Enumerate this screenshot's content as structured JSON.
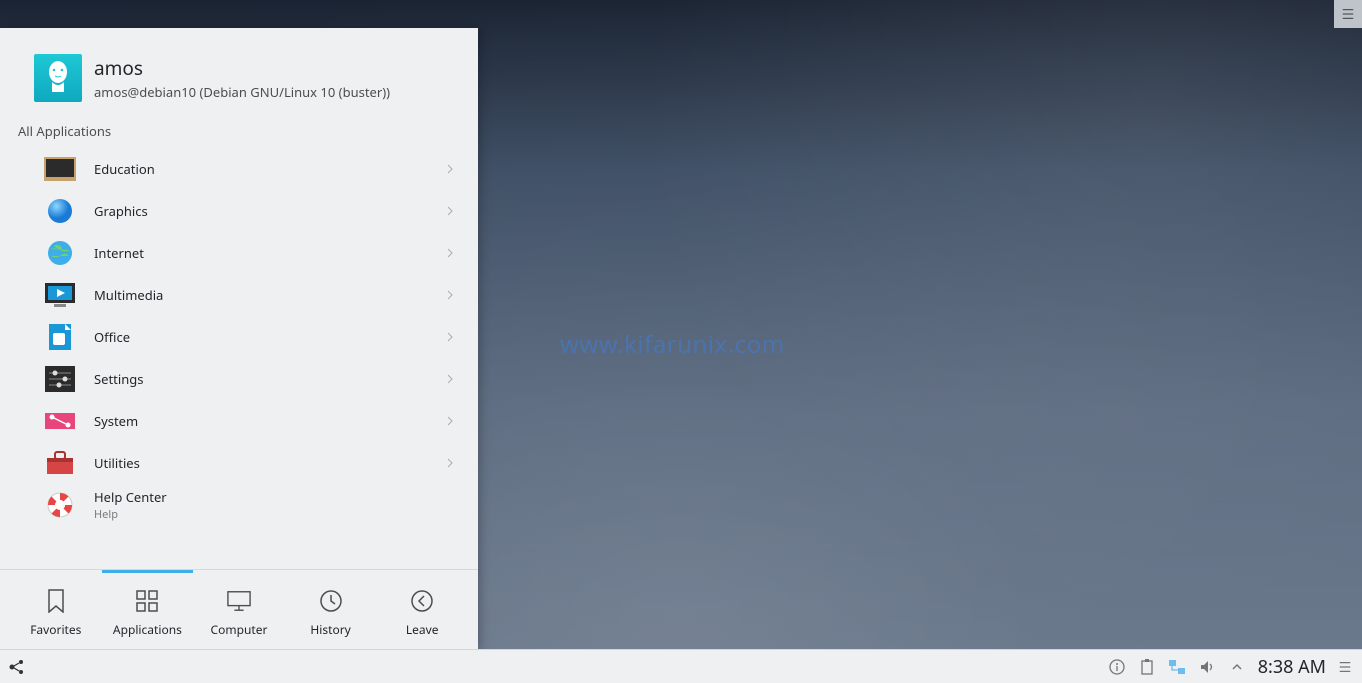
{
  "watermark": "www.kifarunix.com",
  "user": {
    "name": "amos",
    "host": "amos@debian10 (Debian GNU/Linux 10 (buster))"
  },
  "menu": {
    "section_label": "All Applications",
    "categories": [
      {
        "label": "Education",
        "icon": "chalkboard-icon",
        "has_submenu": true
      },
      {
        "label": "Graphics",
        "icon": "sphere-icon",
        "has_submenu": true
      },
      {
        "label": "Internet",
        "icon": "globe-icon",
        "has_submenu": true
      },
      {
        "label": "Multimedia",
        "icon": "media-player-icon",
        "has_submenu": true
      },
      {
        "label": "Office",
        "icon": "document-icon",
        "has_submenu": true
      },
      {
        "label": "Settings",
        "icon": "sliders-icon",
        "has_submenu": true
      },
      {
        "label": "System",
        "icon": "connector-icon",
        "has_submenu": true
      },
      {
        "label": "Utilities",
        "icon": "toolbox-icon",
        "has_submenu": true
      },
      {
        "label": "Help Center",
        "sub": "Help",
        "icon": "lifebuoy-icon",
        "has_submenu": false
      }
    ],
    "tabs": [
      {
        "label": "Favorites",
        "icon": "bookmark-icon"
      },
      {
        "label": "Applications",
        "icon": "grid-icon"
      },
      {
        "label": "Computer",
        "icon": "monitor-icon"
      },
      {
        "label": "History",
        "icon": "clock-icon"
      },
      {
        "label": "Leave",
        "icon": "back-icon"
      }
    ],
    "active_tab": "Applications"
  },
  "taskbar": {
    "clock": "8:38 AM"
  },
  "colors": {
    "accent": "#3daee9",
    "panel_bg": "#eff0f1",
    "text": "#232629"
  }
}
